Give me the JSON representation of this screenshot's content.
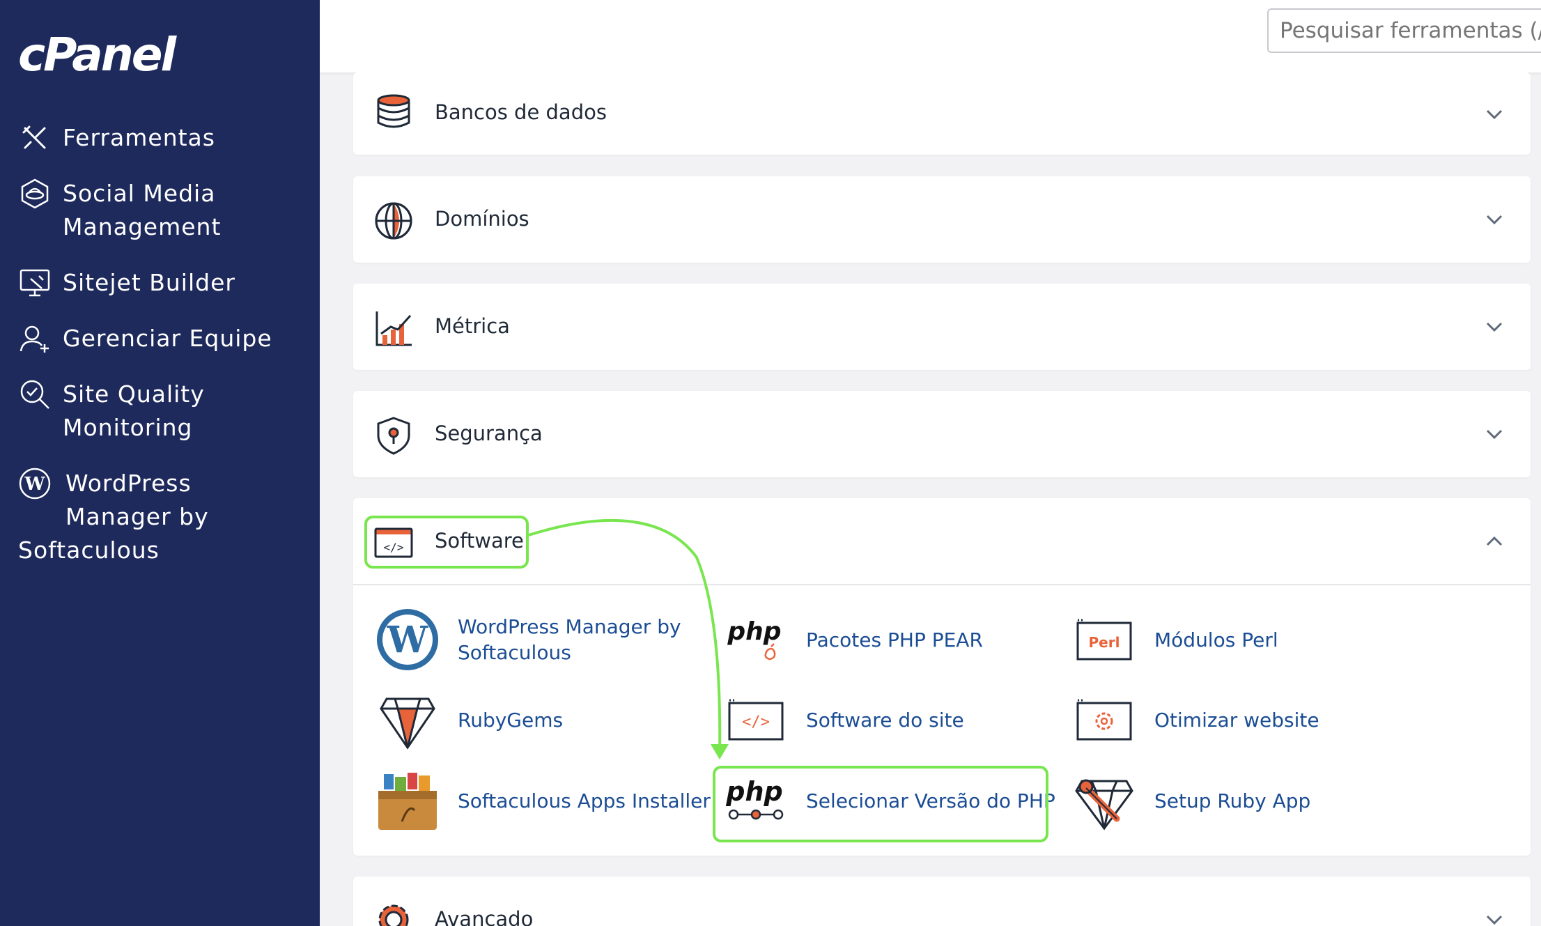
{
  "brand": {
    "logo_text": "cPanel"
  },
  "sidebar": {
    "items": [
      {
        "label": "Ferramentas",
        "icon": "tools-icon"
      },
      {
        "label": "Social Media\nManagement",
        "icon": "social-media-icon"
      },
      {
        "label": "Sitejet Builder",
        "icon": "sitejet-builder-icon"
      },
      {
        "label": "Gerenciar Equipe",
        "icon": "team-icon"
      },
      {
        "label": "Site Quality\nMonitoring",
        "icon": "site-quality-icon"
      },
      {
        "label": "WordPress\nManager by",
        "icon": "wordpress-icon"
      },
      {
        "label": "Softaculous"
      }
    ]
  },
  "header": {
    "search": {
      "placeholder": "Pesquisar ferramentas (/)"
    }
  },
  "sections": [
    {
      "title": "Bancos de dados",
      "icon": "database-icon",
      "state": "collapsed"
    },
    {
      "title": "Domínios",
      "icon": "globe-icon",
      "state": "collapsed"
    },
    {
      "title": "Métrica",
      "icon": "metrics-chart-icon",
      "state": "collapsed"
    },
    {
      "title": "Segurança",
      "icon": "shield-icon",
      "state": "collapsed"
    },
    {
      "title": "Software",
      "icon": "code-window-icon",
      "state": "expanded",
      "tools": [
        {
          "label": "WordPress Manager by\nSoftaculous",
          "icon": "wordpress-icon"
        },
        {
          "label": "Pacotes PHP PEAR",
          "icon": "php-pear-icon",
          "icon_text": "php"
        },
        {
          "label": "Módulos Perl",
          "icon": "perl-icon",
          "icon_text": "Perl"
        },
        {
          "label": "RubyGems",
          "icon": "ruby-gem-icon"
        },
        {
          "label": "Software do site",
          "icon": "code-window-icon",
          "icon_text": "</>"
        },
        {
          "label": "Otimizar website",
          "icon": "gear-window-icon"
        },
        {
          "label": "Softaculous Apps Installer",
          "icon": "softaculous-box-icon"
        },
        {
          "label": "Selecionar Versão do PHP",
          "icon": "php-version-icon",
          "icon_text": "php"
        },
        {
          "label": "Setup Ruby App",
          "icon": "ruby-app-icon"
        }
      ]
    },
    {
      "title": "Avançado",
      "icon": "gear-icon",
      "state": "collapsed"
    }
  ],
  "colors": {
    "sidebar_bg": "#1e2a5c",
    "accent_orange": "#e8633a",
    "link_blue": "#1b4d94",
    "highlight_green": "#79e64f"
  }
}
